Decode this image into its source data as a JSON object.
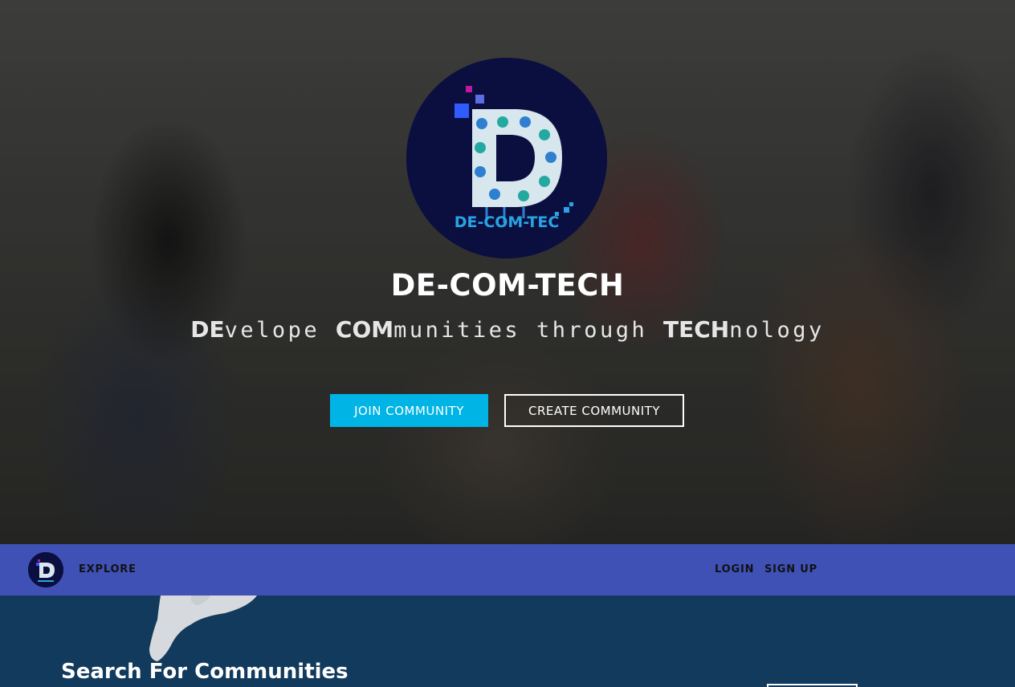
{
  "hero": {
    "logo_text": "DE-COM-TEC",
    "title": "DE-COM-TECH",
    "tagline": [
      {
        "text": "DE",
        "style": "b"
      },
      {
        "text": "velope ",
        "style": "r"
      },
      {
        "text": "COM",
        "style": "b"
      },
      {
        "text": "munities through ",
        "style": "r"
      },
      {
        "text": "TECH",
        "style": "b"
      },
      {
        "text": "nology",
        "style": "r"
      }
    ],
    "join_label": "JOIN COMMUNITY",
    "create_label": "CREATE COMMUNITY"
  },
  "navbar": {
    "explore": "EXPLORE",
    "login": "LOGIN",
    "signup": "SIGN UP"
  },
  "search": {
    "title": "Search For Communities"
  },
  "colors": {
    "accent": "#00b4e6",
    "navbar": "#3f51b5",
    "logo_bg": "#0b0f3f",
    "lower_bg": "#123a5c"
  }
}
